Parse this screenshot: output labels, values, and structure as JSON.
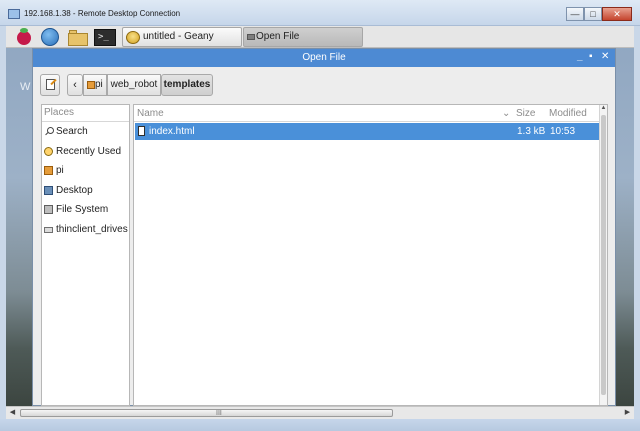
{
  "rdp": {
    "title": "192.168.1.38 - Remote Desktop Connection",
    "minimize_label": "—",
    "maximize_label": "□",
    "close_label": "✕"
  },
  "desktop": {
    "watermark": "W"
  },
  "taskbar": {
    "terminal_glyph": ">_",
    "geany_label": "untitled - Geany",
    "openfile_label": "Open File"
  },
  "dialog": {
    "title": "Open File",
    "min_glyph": "_",
    "max_glyph": "▪",
    "close_glyph": "✕",
    "back_glyph": "‹",
    "path": [
      "pi",
      "web_robot",
      "templates"
    ],
    "places_header": "Places",
    "places": [
      "Search",
      "Recently Used",
      "pi",
      "Desktop",
      "File System",
      "thinclient_drives"
    ],
    "columns": {
      "name": "Name",
      "sort_glyph": "⌄",
      "size": "Size",
      "modified": "Modified"
    },
    "files": [
      {
        "name": "index.html",
        "size": "1.3 kB",
        "modified": "10:53"
      }
    ]
  },
  "hscroll": {
    "left_glyph": "◀",
    "right_glyph": "▶",
    "grip": "III"
  },
  "colors": {
    "selection": "#4a90d9",
    "dialog_titlebar": "#4d8ad3",
    "raspberry": "#c51a4a"
  }
}
